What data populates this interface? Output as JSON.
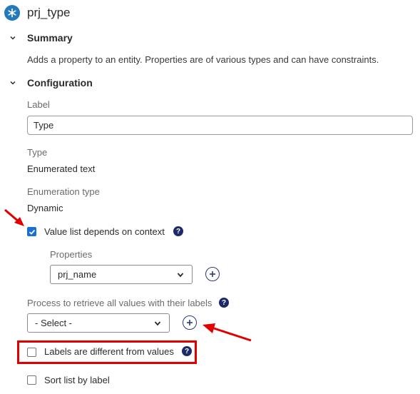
{
  "header": {
    "title": "prj_type",
    "icon": "asterisk-icon"
  },
  "summary": {
    "title": "Summary",
    "description": "Adds a property to an entity. Properties are of various types and can have constraints."
  },
  "configuration": {
    "title": "Configuration",
    "label_field": {
      "label": "Label",
      "value": "Type"
    },
    "type": {
      "label": "Type",
      "value": "Enumerated text"
    },
    "enumeration_type": {
      "label": "Enumeration type",
      "value": "Dynamic"
    },
    "value_list_context": {
      "label": "Value list depends on context",
      "checked": true
    },
    "properties": {
      "label": "Properties",
      "selected": "prj_name"
    },
    "process": {
      "label": "Process to retrieve all values with their labels",
      "selected": "- Select -"
    },
    "labels_different": {
      "label": "Labels are different from values",
      "checked": false
    },
    "sort_list": {
      "label": "Sort list by label",
      "checked": false
    }
  },
  "colors": {
    "accent": "#1a6fd6",
    "annotation": "#e00000",
    "help": "#1e2a68"
  }
}
